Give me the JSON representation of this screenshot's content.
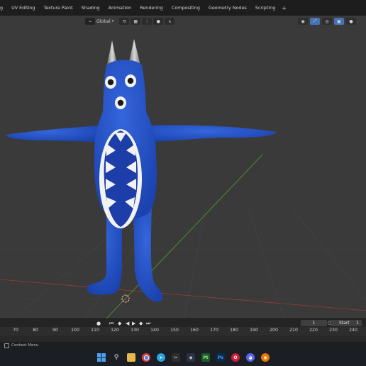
{
  "workspace_tabs": [
    "g",
    "UV Editing",
    "Texture Paint",
    "Shading",
    "Animation",
    "Rendering",
    "Compositing",
    "Geometry Nodes",
    "Scripting"
  ],
  "add_workspace": "+",
  "viewport": {
    "orientation": "Global"
  },
  "timeline": {
    "current_frame": "1",
    "start_label": "Start",
    "start_value": "1",
    "ruler": [
      "70",
      "80",
      "90",
      "100",
      "110",
      "120",
      "130",
      "140",
      "150",
      "160",
      "170",
      "180",
      "190",
      "200",
      "210",
      "220",
      "230",
      "240"
    ]
  },
  "status": {
    "text": "Context Menu"
  },
  "taskbar_icons": [
    "windows-start",
    "search",
    "file-explorer",
    "chrome",
    "telegram",
    "capcut",
    "davinci",
    "photopea",
    "photoshop",
    "opera",
    "discord",
    "blender"
  ],
  "colors": {
    "character_blue": "#2454c8",
    "grid_green": "#5b9a2e",
    "grid_red": "#9b3b3b",
    "active_tool": "#4772b3"
  }
}
